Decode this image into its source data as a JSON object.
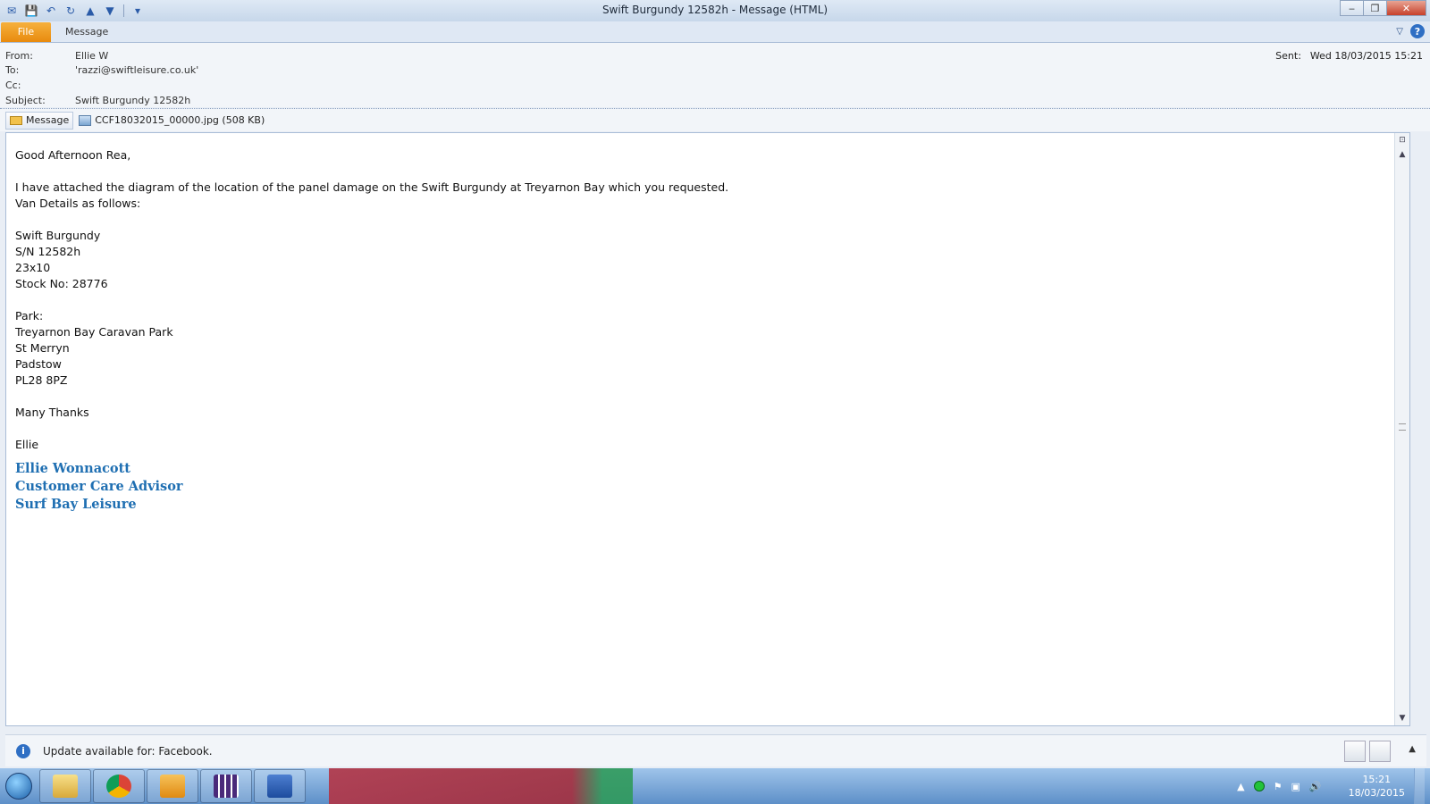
{
  "window": {
    "title": "Swift Burgundy 12582h  -  Message (HTML)"
  },
  "ribbon": {
    "file_label": "File",
    "message_label": "Message"
  },
  "header": {
    "from_label": "From:",
    "from_value": "Ellie W",
    "to_label": "To:",
    "to_value": "'razzi@swiftleisure.co.uk'",
    "cc_label": "Cc:",
    "cc_value": "",
    "subject_label": "Subject:",
    "subject_value": "Swift Burgundy 12582h",
    "sent_label": "Sent:",
    "sent_value": "Wed 18/03/2015 15:21"
  },
  "attachments": {
    "message_tab": "Message",
    "file": "CCF18032015_00000.jpg (508 KB)"
  },
  "body": {
    "greeting": "Good Afternoon Rea,",
    "line1": "I have attached the diagram of the location of the panel damage on the Swift Burgundy at Treyarnon Bay which you requested.",
    "line2": "Van Details as follows:",
    "van_name": "Swift Burgundy",
    "van_sn": "S/N 12582h",
    "van_size": "23x10",
    "van_stock": "Stock No: 28776",
    "park_label": "Park:",
    "park_name": "Treyarnon Bay Caravan Park",
    "park_town": "St Merryn",
    "park_city": "Padstow",
    "park_postcode": "PL28 8PZ",
    "thanks": "Many Thanks",
    "signoff": "Ellie",
    "sig_name": "Ellie Wonnacott",
    "sig_title": "Customer Care Advisor",
    "sig_company": "Surf Bay Leisure"
  },
  "infobar": {
    "text": "Update available for: Facebook."
  },
  "taskbar": {
    "apps": [
      "file-explorer",
      "chrome",
      "outlook",
      "calendar-app",
      "word"
    ],
    "time": "15:21",
    "date": "18/03/2015"
  },
  "colors": {
    "file_tab": "#e88a0e",
    "signature": "#1f6fb2",
    "taskbar": "#5d8fc8"
  }
}
